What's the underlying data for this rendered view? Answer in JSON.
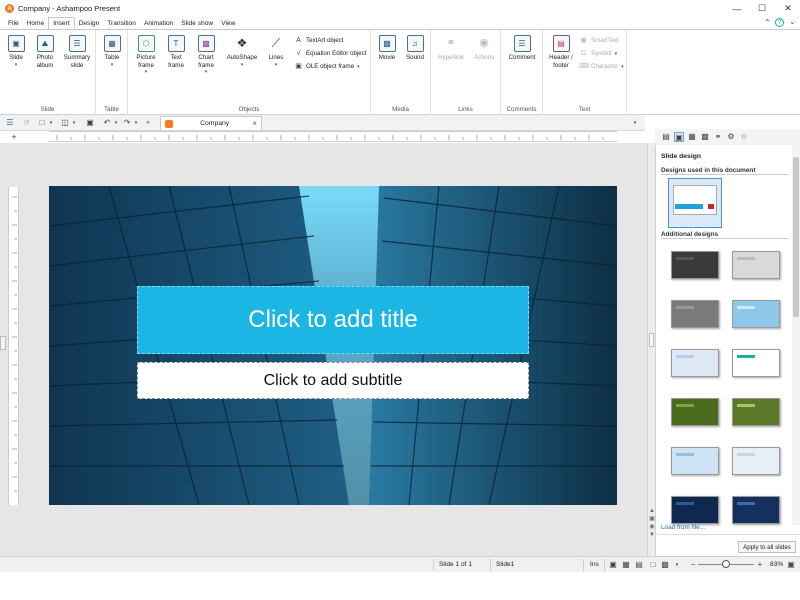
{
  "window": {
    "title": "Company - Ashampoo Present",
    "minimize": "—",
    "maximize": "☐",
    "close": "✕"
  },
  "menubar": {
    "tabs": [
      "File",
      "Home",
      "Insert",
      "Design",
      "Transition",
      "Animation",
      "Slide show",
      "View"
    ],
    "active": "Insert"
  },
  "ribbon": {
    "groups": {
      "slide": "Slide",
      "table": "Table",
      "objects": "Objects",
      "media": "Media",
      "links": "Links",
      "comments": "Comments",
      "text": "Text"
    },
    "buttons": {
      "slide": "Slide",
      "photo_album": "Photo album",
      "summary_slide": "Summary slide",
      "table": "Table",
      "picture_frame": "Picture frame",
      "text_frame": "Text frame",
      "chart_frame": "Chart frame",
      "autoshape": "AutoShape",
      "lines": "Lines",
      "textart": "TextArt object",
      "equation": "Equation Editor object",
      "ole": "OLE object frame",
      "movie": "Movie",
      "sound": "Sound",
      "hyperlink": "Hyperlink",
      "actions": "Actions",
      "comment": "Comment",
      "header_footer": "Header / footer",
      "smarttext": "SmartText",
      "symbol": "Symbol",
      "character": "Character"
    }
  },
  "document_tab": {
    "label": "Company",
    "close": "×"
  },
  "slide": {
    "title_placeholder": "Click to add title",
    "subtitle_placeholder": "Click to add subtitle"
  },
  "right_pane": {
    "heading": "Slide design",
    "used_label": "Designs used in this document",
    "additional_label": "Additional designs",
    "load_link": "Load from file...",
    "apply_button": "Apply to all slides",
    "thumbnails": [
      {
        "bg": "#3a3a3a",
        "accent": "#555"
      },
      {
        "bg": "#d9d9d9",
        "accent": "#bbb"
      },
      {
        "bg": "#7a7a7a",
        "accent": "#999"
      },
      {
        "bg": "#8fc7ea",
        "accent": "#cfe9f8"
      },
      {
        "bg": "#dfe9f5",
        "accent": "#b5d0ea"
      },
      {
        "bg": "#ffffff",
        "accent": "#1fae9a"
      },
      {
        "bg": "#4a6b1e",
        "accent": "#7fa33a"
      },
      {
        "bg": "#5b7a2a",
        "accent": "#a8c46a"
      },
      {
        "bg": "#cfe3f5",
        "accent": "#8ec0e8"
      },
      {
        "bg": "#e6eef6",
        "accent": "#c0d6ea"
      },
      {
        "bg": "#0f2850",
        "accent": "#2f5a9a"
      },
      {
        "bg": "#14305e",
        "accent": "#3a6cb0"
      }
    ]
  },
  "statusbar": {
    "slide_pos": "Slide 1 of 1",
    "slide_name": "Slide1",
    "mode": "Ins",
    "zoom": "83%",
    "zoom_level": 0.5
  }
}
